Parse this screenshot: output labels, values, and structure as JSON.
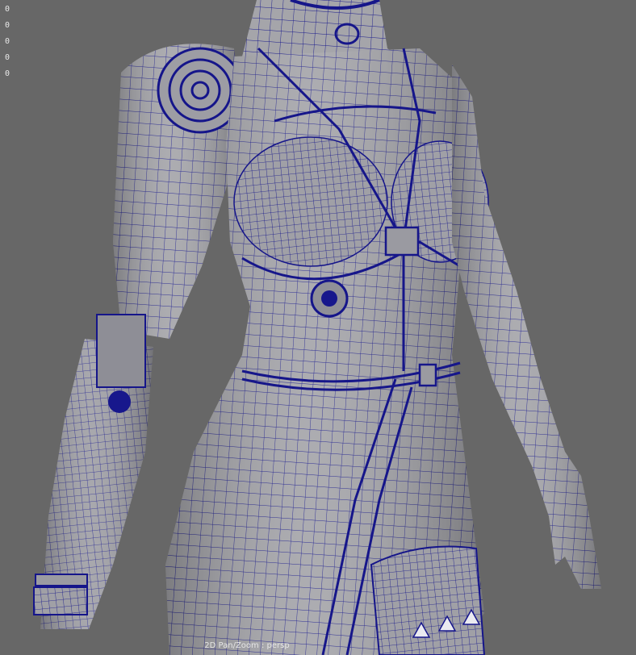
{
  "viewport": {
    "hud_values": [
      "0",
      "0",
      "0",
      "0",
      "0"
    ],
    "camera_label": "2D Pan/Zoom : persp"
  },
  "colors": {
    "background": "#676767",
    "surface": "#a9a9ae",
    "wireframe": "#14148a"
  },
  "scene": {
    "subject": "character-torso-wireframe-model"
  }
}
